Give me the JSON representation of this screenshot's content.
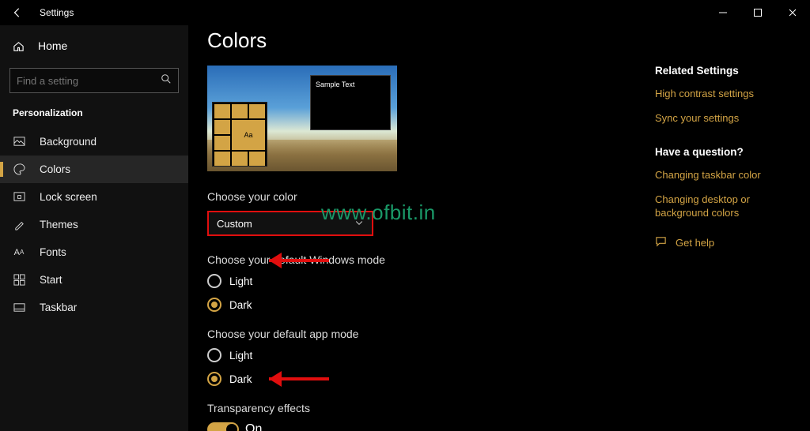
{
  "titlebar": {
    "title": "Settings"
  },
  "sidebar": {
    "home": "Home",
    "search_placeholder": "Find a setting",
    "category": "Personalization",
    "items": [
      {
        "label": "Background"
      },
      {
        "label": "Colors"
      },
      {
        "label": "Lock screen"
      },
      {
        "label": "Themes"
      },
      {
        "label": "Fonts"
      },
      {
        "label": "Start"
      },
      {
        "label": "Taskbar"
      }
    ]
  },
  "main": {
    "heading": "Colors",
    "preview_sample": "Sample Text",
    "preview_aa": "Aa",
    "choose_color_label": "Choose your color",
    "choose_color_value": "Custom",
    "windows_mode_label": "Choose your default Windows mode",
    "windows_mode_options": {
      "light": "Light",
      "dark": "Dark"
    },
    "windows_mode_selected": "dark",
    "app_mode_label": "Choose your default app mode",
    "app_mode_options": {
      "light": "Light",
      "dark": "Dark"
    },
    "app_mode_selected": "dark",
    "transparency_label": "Transparency effects",
    "transparency_value": "On"
  },
  "right": {
    "related_heading": "Related Settings",
    "links": [
      "High contrast settings",
      "Sync your settings"
    ],
    "question_heading": "Have a question?",
    "question_links": [
      "Changing taskbar color",
      "Changing desktop or background colors"
    ],
    "get_help": "Get help"
  },
  "watermark": "www.ofbit.in",
  "accent": "#d3a445"
}
